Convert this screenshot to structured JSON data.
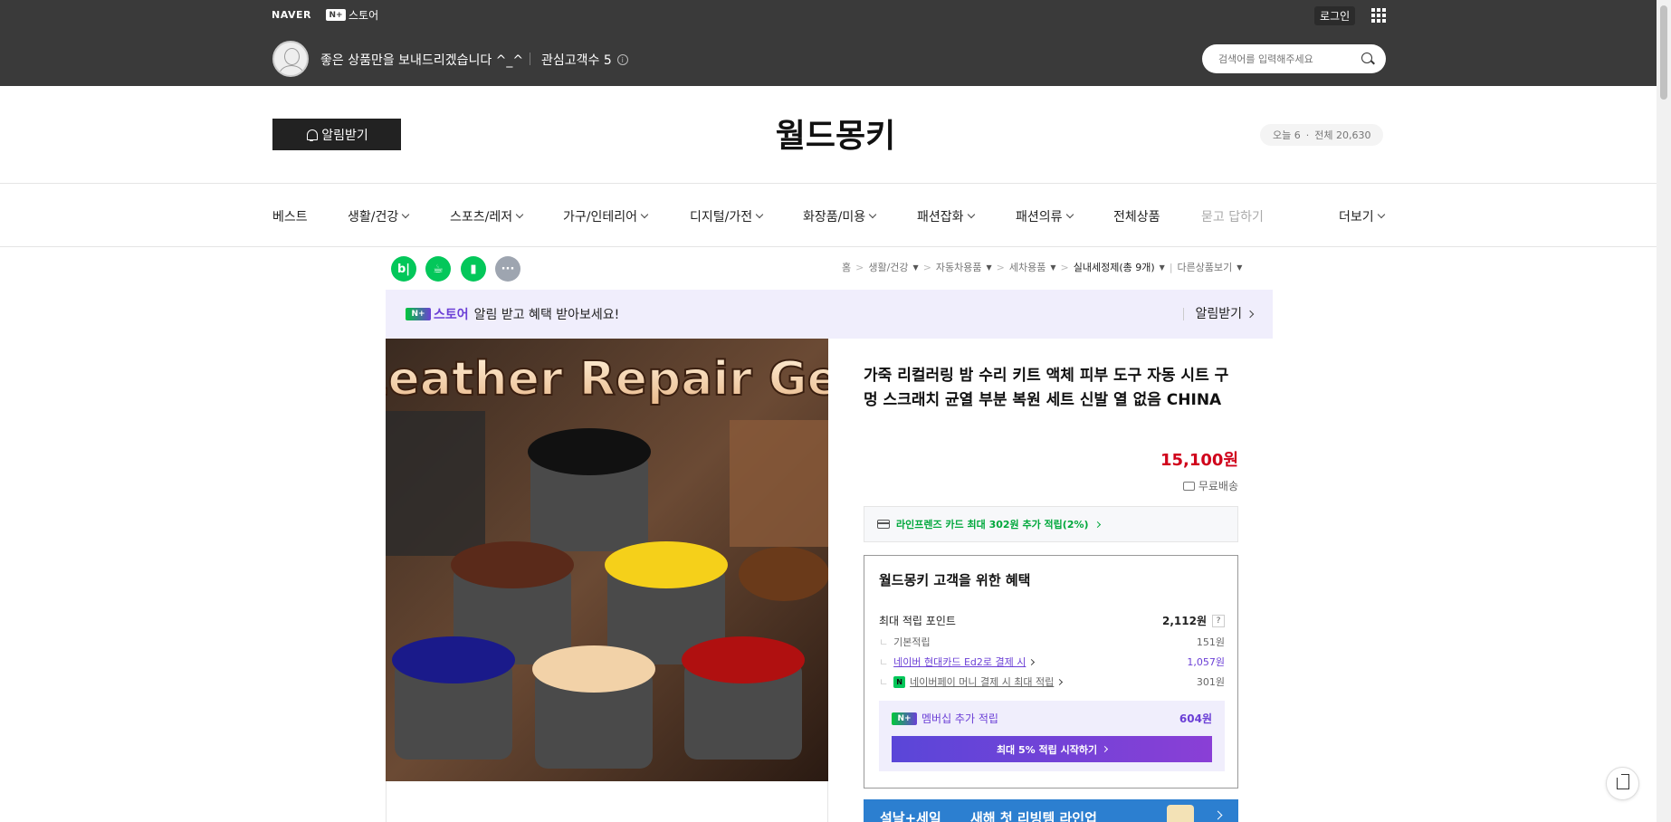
{
  "topbar": {
    "naver_logo": "NAVER",
    "nstore_badge": "N+",
    "nstore_label": "스토어",
    "login": "로그인",
    "store_description": "좋은 상품만을 보내드리겠습니다 ^_^",
    "fans_label": "관심고객수 5",
    "search_placeholder": "검색어를 입력해주세요"
  },
  "header": {
    "alarm_button": "알림받기",
    "store_name": "월드몽키",
    "today_visits": "오늘 6",
    "total_visits": "전체 20,630"
  },
  "nav": [
    {
      "label": "베스트",
      "dropdown": false
    },
    {
      "label": "생활/건강",
      "dropdown": true
    },
    {
      "label": "스포츠/레저",
      "dropdown": true
    },
    {
      "label": "가구/인테리어",
      "dropdown": true
    },
    {
      "label": "디지털/가전",
      "dropdown": true
    },
    {
      "label": "화장품/미용",
      "dropdown": true
    },
    {
      "label": "패션잡화",
      "dropdown": true
    },
    {
      "label": "패션의류",
      "dropdown": true
    },
    {
      "label": "전체상품",
      "dropdown": false
    },
    {
      "label": "묻고 답하기",
      "dropdown": false
    },
    {
      "label": "더보기",
      "dropdown": true
    }
  ],
  "share_icons": [
    {
      "name": "blog-share-icon",
      "label": "b|",
      "color": "#03c75a"
    },
    {
      "name": "cafe-share-icon",
      "label": "☕",
      "color": "#03c75a"
    },
    {
      "name": "bookmark-share-icon",
      "label": "▮",
      "color": "#03c75a"
    },
    {
      "name": "more-share-icon",
      "label": "···",
      "color": "#9ea5b0"
    }
  ],
  "breadcrumb": {
    "home": "홈",
    "level1": "생활/건강",
    "level2": "자동차용품",
    "level3": "세차용품",
    "current": "실내세정제(총 9개)",
    "other": "다른상품보기"
  },
  "banner": {
    "badge": "N+",
    "logo_text": "스토어",
    "text": "알림 받고 혜택 받아보세요!",
    "alarm": "알림받기"
  },
  "product": {
    "image_text": "Leather Repair Gel",
    "title": "가죽 리컬러링 밤 수리 키트 액체 피부 도구 자동 시트 구멍 스크래치 균열 부분 복원 세트 신발 열 없음 CHINA",
    "price_number": "15,100",
    "price_unit": "원",
    "shipping": "무료배송",
    "card_benefit": "라인프렌즈 카드 최대 302원 추가 적립(2%)"
  },
  "benefit": {
    "title": "월드몽키 고객을 위한 혜택",
    "max_points_label": "최대 적립 포인트",
    "max_points_value": "2,112원",
    "qmark": "?",
    "basic_label": "기본적립",
    "basic_value": "151원",
    "card_label": "네이버 현대카드 Ed2로 결제 시",
    "card_value": "1,057원",
    "npay_label": "네이버페이 머니 결제 시 최대 적립",
    "npay_value": "301원",
    "member_label": "멤버십 추가 적립",
    "member_value": "604원",
    "member_button": "최대 5% 적립 시작하기"
  },
  "promo": {
    "text1": "설날+세일",
    "text2": "새해 첫 리빙템 라인업"
  },
  "colors": {
    "topbar": "#3a3a3a",
    "price": "#d0021b",
    "naver_green": "#03c75a",
    "membership_purple": "#6b3fd6"
  }
}
